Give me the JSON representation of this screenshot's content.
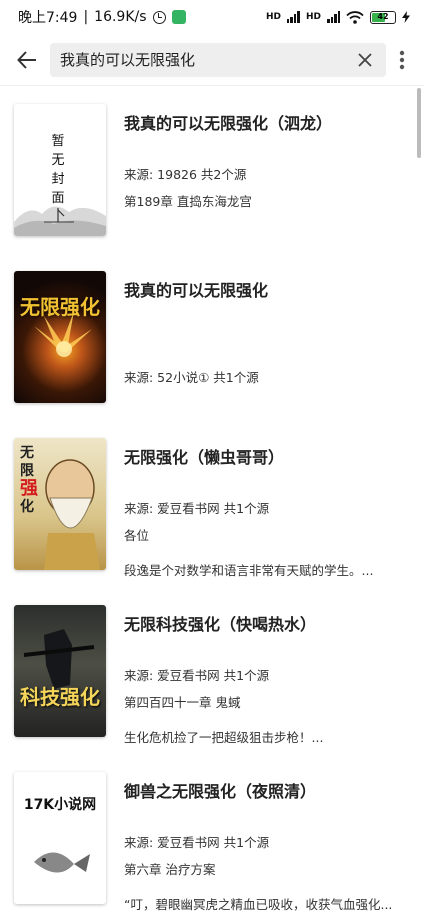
{
  "status": {
    "time": "晚上7:49",
    "speed": "16.9K/s",
    "net1": "HD",
    "net2": "HD",
    "battery": "42"
  },
  "search": {
    "query": "我真的可以无限强化"
  },
  "books": [
    {
      "title": "我真的可以无限强化（泗龙）",
      "source": "来源: 19826  共2个源",
      "latest": "第189章 直捣东海龙宫",
      "desc": "",
      "cover_text": [
        "暂",
        "无",
        "封",
        "面"
      ]
    },
    {
      "title": "我真的可以无限强化",
      "source": "来源: 52小说①  共1个源",
      "latest": "",
      "desc": "",
      "cover_text": [
        "无限强化"
      ]
    },
    {
      "title": "无限强化（懒虫哥哥）",
      "source": "来源: 爱豆看书网  共1个源",
      "latest": "各位",
      "desc": "段逸是个对数学和语言非常有天赋的学生。...",
      "cover_text": [
        "无",
        "限",
        "强",
        "化"
      ]
    },
    {
      "title": "无限科技强化（快喝热水）",
      "source": "来源: 爱豆看书网  共1个源",
      "latest": "第四百四十一章 鬼蜮",
      "desc": "生化危机捡了一把超级狙击步枪！...",
      "cover_text": [
        "科技强化"
      ]
    },
    {
      "title": "御兽之无限强化（夜照清）",
      "source": "来源: 爱豆看书网  共1个源",
      "latest": "第六章 治疗方案",
      "desc": "“叮，碧眼幽冥虎之精血已吸收，收获气血强化...",
      "cover_text": [
        "17K小说网"
      ]
    }
  ]
}
